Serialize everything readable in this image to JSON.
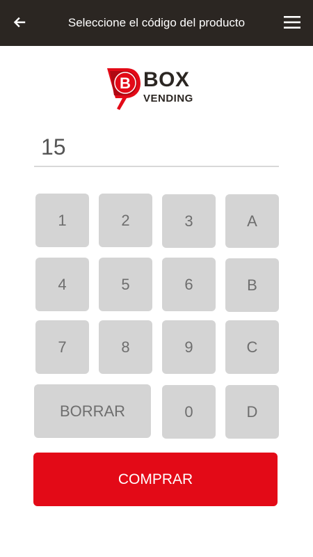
{
  "header": {
    "title": "Seleccione el código del producto",
    "back_icon": "arrow-left-icon",
    "menu_icon": "hamburger-menu-icon",
    "background_color": "#2b2622"
  },
  "logo": {
    "line1": "BOX",
    "line2": "VENDING",
    "badge_letter": "B",
    "brand_color": "#e30a17"
  },
  "code_field": {
    "value": "15"
  },
  "keypad": {
    "keys": {
      "k1": "1",
      "k2": "2",
      "k3": "3",
      "kA": "A",
      "k4": "4",
      "k5": "5",
      "k6": "6",
      "kB": "B",
      "k7": "7",
      "k8": "8",
      "k9": "9",
      "kC": "C",
      "clear": "BORRAR",
      "k0": "0",
      "kD": "D"
    }
  },
  "buy_button": {
    "label": "COMPRAR",
    "color": "#e30a17"
  }
}
